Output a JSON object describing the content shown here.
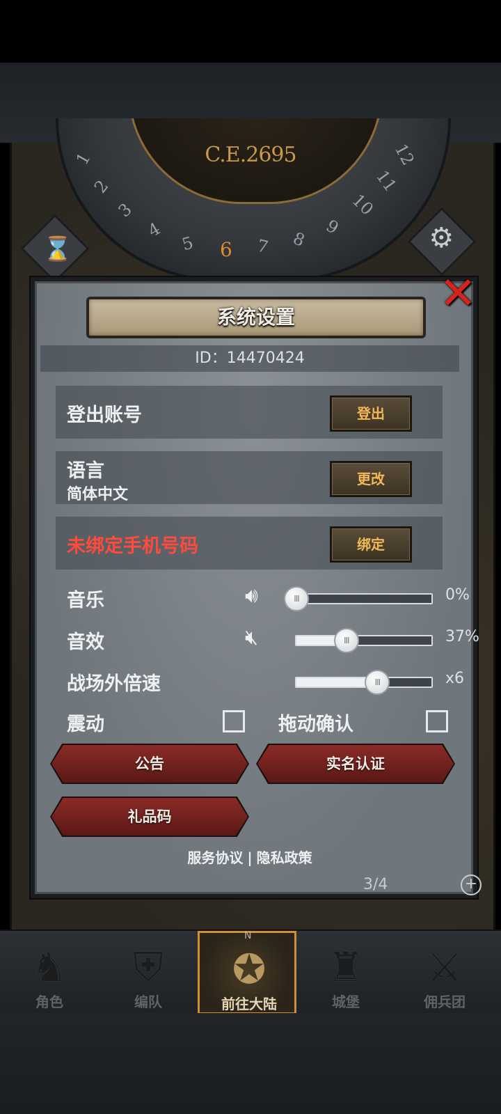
{
  "top": {
    "era": "C.E.2695",
    "dial_numbers": [
      "1",
      "2",
      "3",
      "4",
      "5",
      "6",
      "7",
      "8",
      "9",
      "10",
      "11",
      "12"
    ],
    "dial_active": "6"
  },
  "dialog": {
    "title": "系统设置",
    "id_text": "ID：14470424",
    "account": {
      "label": "登出账号",
      "button": "登出"
    },
    "language": {
      "label": "语言",
      "value": "简体中文",
      "button": "更改"
    },
    "phone": {
      "label": "未绑定手机号码",
      "button": "绑定",
      "label_color": "#ff4a3c"
    },
    "music": {
      "label": "音乐",
      "value_text": "0%",
      "level": 0
    },
    "sfx": {
      "label": "音效",
      "value_text": "37%",
      "level": 0.37
    },
    "speed": {
      "label": "战场外倍速",
      "value_text": "x6",
      "level": 0.6
    },
    "vibration": {
      "label": "震动",
      "checked": false
    },
    "drag_confirm": {
      "label": "拖动确认",
      "checked": false
    },
    "buttons": {
      "notice": "公告",
      "real_name": "实名认证",
      "gift_code": "礼品码"
    },
    "footer": {
      "terms": "服务协议",
      "separator": "|",
      "privacy": "隐私政策"
    }
  },
  "under_panel": {
    "resource_count": "3/4"
  },
  "nav": {
    "items": [
      {
        "label": "角色",
        "icon": "knight-icon"
      },
      {
        "label": "编队",
        "icon": "helmet-icon"
      },
      {
        "label": "前往大陆",
        "icon": "compass-icon",
        "active": true
      },
      {
        "label": "城堡",
        "icon": "castle-icon"
      },
      {
        "label": "佣兵团",
        "icon": "mercenary-icon"
      }
    ]
  },
  "colors": {
    "accent_gold": "#f2b856",
    "warning_red": "#ff4a3c",
    "active_tab_border": "#d09030"
  }
}
